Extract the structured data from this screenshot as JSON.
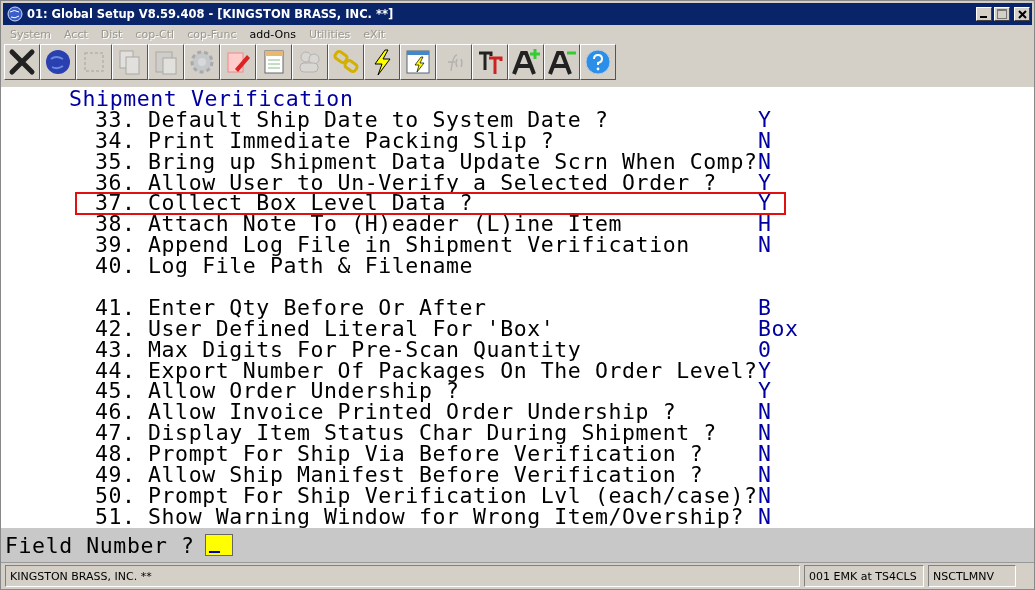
{
  "window": {
    "title": "01: Global Setup V8.59.408 - [KINGSTON BRASS, INC. **]"
  },
  "menu": [
    {
      "label": "System",
      "disabled": true
    },
    {
      "label": "Acct",
      "disabled": true
    },
    {
      "label": "Dist",
      "disabled": true
    },
    {
      "label": "cop-Ctl",
      "disabled": true
    },
    {
      "label": "cop-Func",
      "disabled": true
    },
    {
      "label": "add-Ons",
      "disabled": false
    },
    {
      "label": "Utilities",
      "disabled": true
    },
    {
      "label": "eXit",
      "disabled": true
    }
  ],
  "toolbar": [
    {
      "kind": "close",
      "disabled": false
    },
    {
      "kind": "globe",
      "disabled": false
    },
    {
      "kind": "select",
      "disabled": true
    },
    {
      "kind": "copy",
      "disabled": true
    },
    {
      "kind": "paste",
      "disabled": true
    },
    {
      "kind": "gear",
      "disabled": true
    },
    {
      "kind": "edit",
      "disabled": false
    },
    {
      "kind": "notepad",
      "disabled": false
    },
    {
      "kind": "people",
      "disabled": true
    },
    {
      "kind": "link",
      "disabled": false
    },
    {
      "kind": "bolt",
      "disabled": false
    },
    {
      "kind": "window-bolt",
      "disabled": false
    },
    {
      "kind": "function",
      "disabled": true
    },
    {
      "kind": "font",
      "disabled": false
    },
    {
      "kind": "font-bigger",
      "disabled": false
    },
    {
      "kind": "font-smaller",
      "disabled": false
    },
    {
      "kind": "help",
      "disabled": false
    }
  ],
  "section_title": "Shipment Verification",
  "settings_groups": [
    [
      {
        "number": "33.",
        "label": "Default Ship Date to System Date ?",
        "value": "Y",
        "selected": false
      },
      {
        "number": "34.",
        "label": "Print Immediate Packing Slip ?",
        "value": "N",
        "selected": false
      },
      {
        "number": "35.",
        "label": "Bring up Shipment Data Update Scrn When Comp?",
        "value": "N",
        "selected": false
      },
      {
        "number": "36.",
        "label": "Allow User to Un-Verify a Selected Order ?",
        "value": "Y",
        "selected": false
      },
      {
        "number": "37.",
        "label": "Collect Box Level Data ?",
        "value": "Y",
        "selected": true
      },
      {
        "number": "38.",
        "label": "Attach Note To (H)eader (L)ine Item",
        "value": "H",
        "selected": false
      },
      {
        "number": "39.",
        "label": "Append Log File in Shipment Verification",
        "value": "N",
        "selected": false
      },
      {
        "number": "40.",
        "label": "Log File Path & Filename",
        "selected": false
      }
    ],
    [
      {
        "number": "41.",
        "label": "Enter Qty Before Or After",
        "value": "B",
        "selected": false
      },
      {
        "number": "42.",
        "label": "User Defined Literal For 'Box'",
        "value": "Box",
        "selected": false
      },
      {
        "number": "43.",
        "label": "Max Digits For Pre-Scan Quantity",
        "value": "0",
        "selected": false
      },
      {
        "number": "44.",
        "label": "Export Number Of Packages On The Order Level?",
        "value": "Y",
        "selected": false
      },
      {
        "number": "45.",
        "label": "Allow Order Undership ?",
        "value": "Y",
        "selected": false
      },
      {
        "number": "46.",
        "label": "Allow Invoice Printed Order Undership ?",
        "value": "N",
        "selected": false
      },
      {
        "number": "47.",
        "label": "Display Item Status Char During Shipment ?",
        "value": "N",
        "selected": false
      },
      {
        "number": "48.",
        "label": "Prompt For Ship Via Before Verification ?",
        "value": "N",
        "selected": false
      },
      {
        "number": "49.",
        "label": "Allow Ship Manifest Before Verification ?",
        "value": "N",
        "selected": false
      },
      {
        "number": "50.",
        "label": "Prompt For Ship Verification Lvl (each/case)?",
        "value": "N",
        "selected": false
      },
      {
        "number": "51.",
        "label": "Show Warning Window for Wrong Item/Overship?",
        "value": "N",
        "selected": false
      }
    ]
  ],
  "prompt": {
    "label": "Field Number ?"
  },
  "status_bar": [
    "KINGSTON BRASS, INC. **",
    "001 EMK at TS4CLS",
    "NSCTLMNV"
  ]
}
